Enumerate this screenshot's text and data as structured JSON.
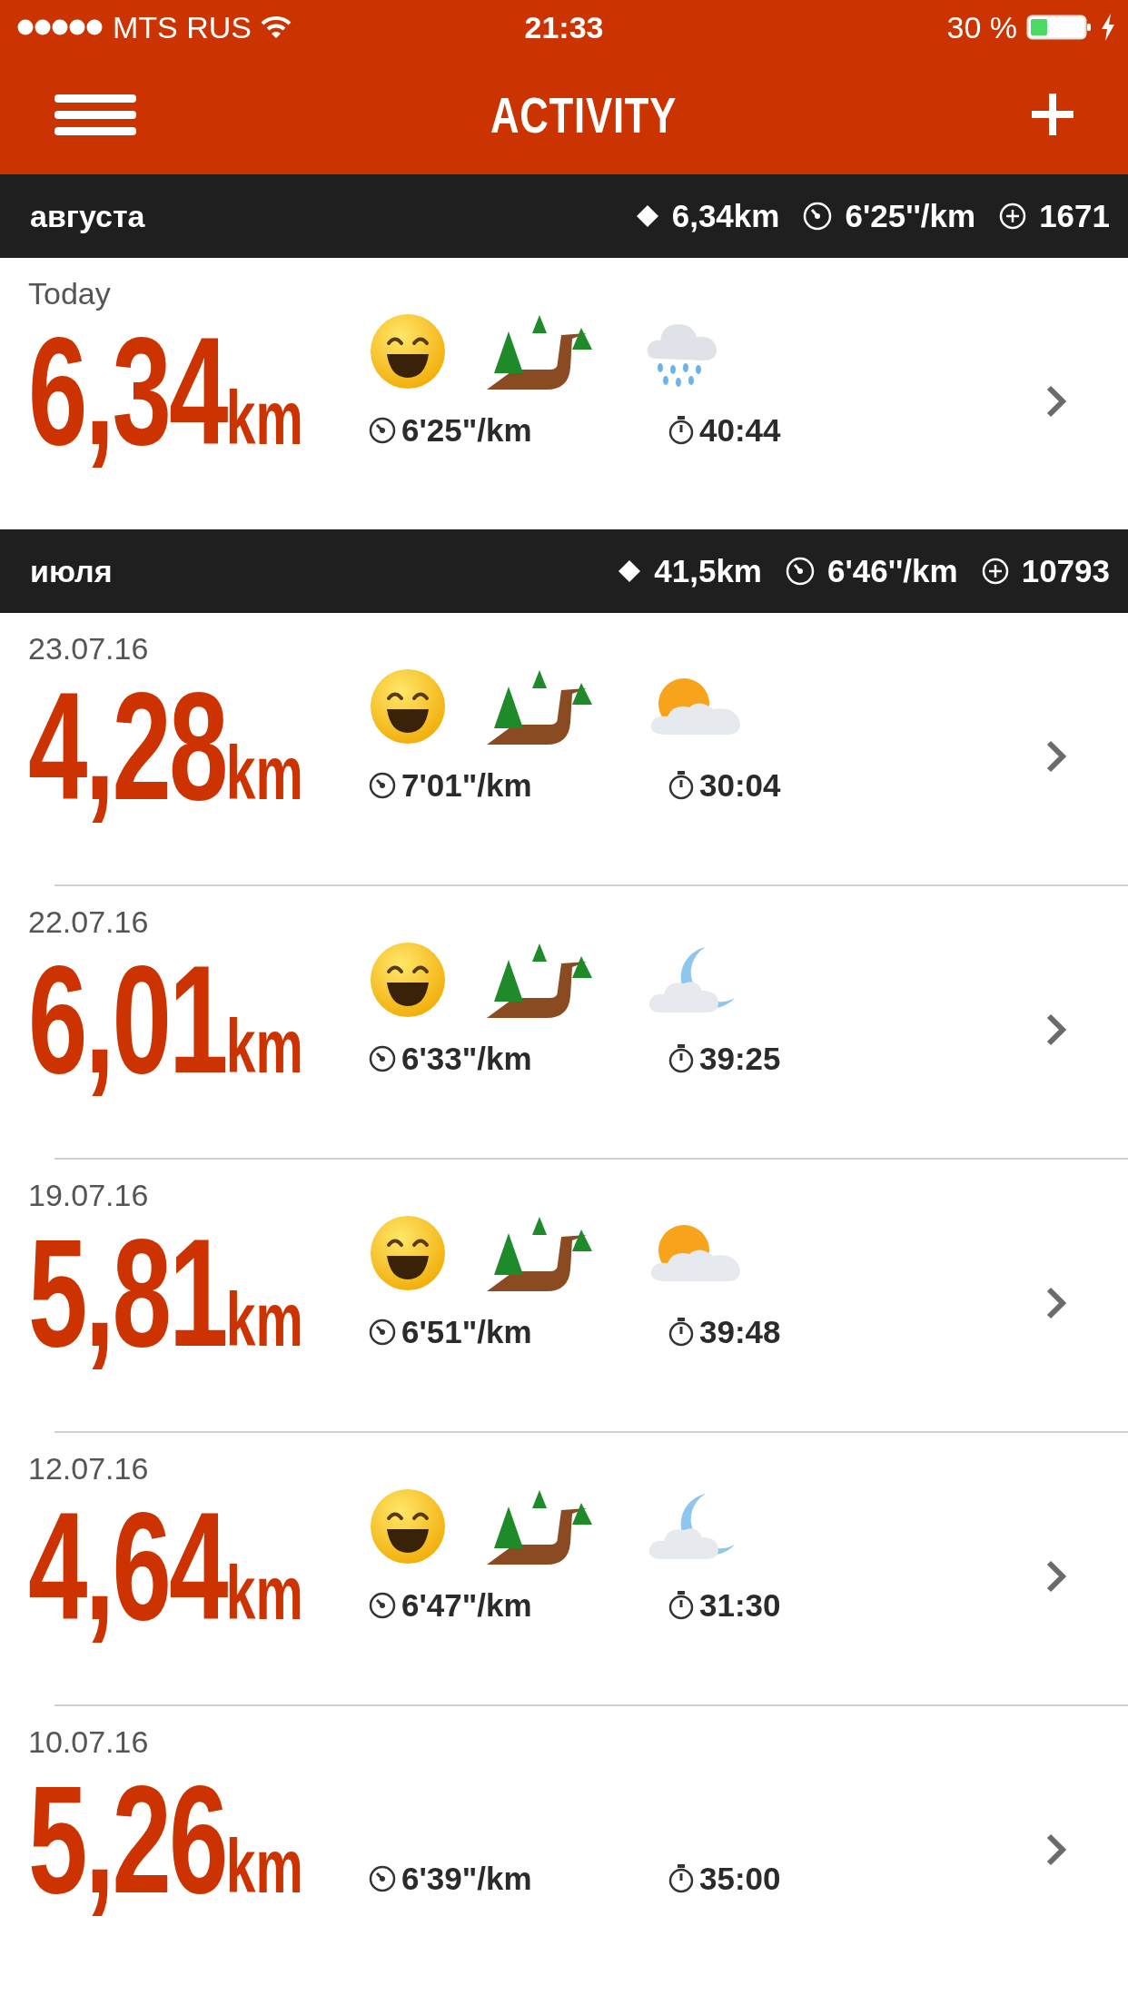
{
  "status_bar": {
    "carrier": "MTS RUS",
    "time": "21:33",
    "battery": "30 %"
  },
  "nav": {
    "title": "ACTIVITY"
  },
  "sections": [
    {
      "month": "августа",
      "distance": "6,34km",
      "pace": "6'25''/km",
      "calories": "1671",
      "runs": [
        {
          "date": "Today",
          "distance": "6,34",
          "unit": "km",
          "icons": [
            {
              "kind": "smiley"
            },
            {
              "kind": "trail"
            },
            {
              "kind": "rain"
            }
          ],
          "pace": "6'25\"/km",
          "duration": "40:44"
        }
      ]
    },
    {
      "month": "июля",
      "distance": "41,5km",
      "pace": "6'46''/km",
      "calories": "10793",
      "runs": [
        {
          "date": "23.07.16",
          "distance": "4,28",
          "unit": "km",
          "icons": [
            {
              "kind": "smiley"
            },
            {
              "kind": "trail"
            },
            {
              "kind": "sun"
            }
          ],
          "pace": "7'01\"/km",
          "duration": "30:04"
        },
        {
          "date": "22.07.16",
          "distance": "6,01",
          "unit": "km",
          "icons": [
            {
              "kind": "smiley"
            },
            {
              "kind": "trail"
            },
            {
              "kind": "moon"
            }
          ],
          "pace": "6'33\"/km",
          "duration": "39:25"
        },
        {
          "date": "19.07.16",
          "distance": "5,81",
          "unit": "km",
          "icons": [
            {
              "kind": "smiley"
            },
            {
              "kind": "trail"
            },
            {
              "kind": "sun"
            }
          ],
          "pace": "6'51\"/km",
          "duration": "39:48"
        },
        {
          "date": "12.07.16",
          "distance": "4,64",
          "unit": "km",
          "icons": [
            {
              "kind": "smiley"
            },
            {
              "kind": "trail"
            },
            {
              "kind": "moon"
            }
          ],
          "pace": "6'47\"/km",
          "duration": "31:30"
        },
        {
          "date": "10.07.16",
          "distance": "5,26",
          "unit": "km",
          "pace": "6'39\"/km",
          "duration": "35:00"
        }
      ]
    }
  ]
}
